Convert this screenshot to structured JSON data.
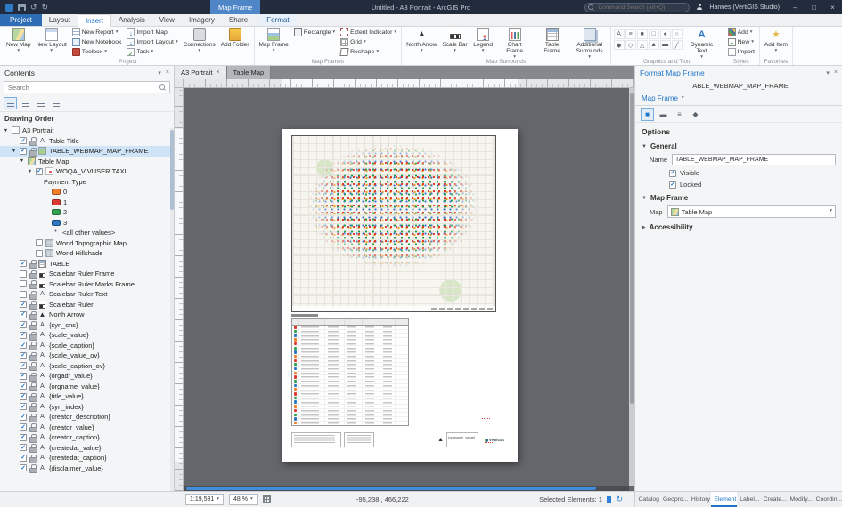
{
  "titlebar": {
    "context_chip": "Map Frame",
    "title": "Untitled - A3 Portrait - ArcGIS Pro",
    "search_placeholder": "Command Search (Alt+Q)",
    "user": "Hannes (VertiGIS Studio)"
  },
  "ribbon": {
    "tabs": [
      {
        "label": "Project",
        "kind": "project"
      },
      {
        "label": "Layout",
        "kind": "normal"
      },
      {
        "label": "Insert",
        "kind": "active"
      },
      {
        "label": "Analysis",
        "kind": "normal"
      },
      {
        "label": "View",
        "kind": "normal"
      },
      {
        "label": "Imagery",
        "kind": "normal"
      },
      {
        "label": "Share",
        "kind": "normal"
      },
      {
        "label": "Format",
        "kind": "contextual"
      }
    ],
    "groups": [
      {
        "label": "Project",
        "cols": [
          {
            "type": "big",
            "items": [
              {
                "label": "New Map",
                "arrow": true,
                "icon": "map"
              },
              {
                "label": "New Layout",
                "arrow": true,
                "icon": "layout"
              }
            ]
          },
          {
            "type": "stack",
            "items": [
              {
                "label": "New Report",
                "arrow": true,
                "icon": "report"
              },
              {
                "label": "New Notebook",
                "icon": "notebook"
              },
              {
                "label": "Toolbox",
                "arrow": true,
                "icon": "toolbox"
              }
            ]
          },
          {
            "type": "stack",
            "items": [
              {
                "label": "Import Map",
                "icon": "importmap"
              },
              {
                "label": "Import Layout",
                "arrow": true,
                "icon": "importmap"
              },
              {
                "label": "Task",
                "arrow": true,
                "icon": "task"
              }
            ]
          },
          {
            "type": "big",
            "items": [
              {
                "label": "Connections",
                "arrow": true,
                "icon": "connections"
              },
              {
                "label": "Add Folder",
                "icon": "folder"
              }
            ]
          }
        ]
      },
      {
        "label": "Map Frames",
        "cols": [
          {
            "type": "big",
            "items": [
              {
                "label": "Map Frame",
                "arrow": true,
                "icon": "mapframe"
              }
            ]
          },
          {
            "type": "stack",
            "items": [
              {
                "label": "Rectangle",
                "arrow": true,
                "icon": "rect"
              }
            ]
          },
          {
            "type": "stack",
            "items": [
              {
                "label": "Extent Indicator",
                "arrow": true,
                "icon": "extent"
              },
              {
                "label": "Grid",
                "arrow": true,
                "icon": "grid"
              },
              {
                "label": "Reshape",
                "arrow": true,
                "icon": "reshape"
              }
            ]
          }
        ]
      },
      {
        "label": "Map Surrounds",
        "cols": [
          {
            "type": "big",
            "items": [
              {
                "label": "North Arrow",
                "arrow": true,
                "icon": "north"
              },
              {
                "label": "Scale Bar",
                "arrow": true,
                "icon": "scalebar"
              },
              {
                "label": "Legend",
                "arrow": true,
                "icon": "legend"
              },
              {
                "label": "Chart Frame",
                "arrow": true,
                "icon": "chart"
              },
              {
                "label": "Table Frame",
                "icon": "tableframe"
              },
              {
                "label": "Additional Surrounds",
                "arrow": true,
                "icon": "addsurr"
              }
            ]
          }
        ]
      },
      {
        "label": "Graphics and Text",
        "cols": [
          {
            "type": "icons",
            "items": [
              "A",
              "≡",
              "■",
              "□",
              "●",
              "○",
              "◆",
              "◇",
              "△",
              "▲",
              "▬",
              "╱"
            ]
          },
          {
            "type": "big",
            "items": [
              {
                "label": "Dynamic Text",
                "arrow": true,
                "icon": "dyntext"
              }
            ]
          }
        ]
      },
      {
        "label": "Styles",
        "cols": [
          {
            "type": "stack",
            "items": [
              {
                "label": "Add",
                "arrow": true,
                "icon": "styleadd"
              },
              {
                "label": "New",
                "arrow": true,
                "icon": "stylenew"
              },
              {
                "label": "Import",
                "icon": "importmap"
              }
            ]
          }
        ]
      },
      {
        "label": "Favorites",
        "cols": [
          {
            "type": "big",
            "items": [
              {
                "label": "Add Item",
                "arrow": true,
                "icon": "additem"
              }
            ]
          }
        ]
      }
    ]
  },
  "contents": {
    "title": "Contents",
    "search_placeholder": "Search",
    "section": "Drawing Order",
    "tree": [
      {
        "label": "A3 Portrait",
        "level": 0,
        "icon": "page",
        "expand": true
      },
      {
        "label": "Table Title",
        "level": 1,
        "check": "on",
        "lock": true,
        "icon": "textel"
      },
      {
        "label": "TABLE_WEBMAP_MAP_FRAME",
        "level": 1,
        "check": "on",
        "lock": true,
        "icon": "mapframe",
        "expand": true,
        "selected": true
      },
      {
        "label": "Table Map",
        "level": 2,
        "icon": "map",
        "expand": true
      },
      {
        "label": "WOQA_V:VUSER.TAXI",
        "level": 3,
        "check": "on",
        "icon": "layer",
        "expand": true
      },
      {
        "label": "Payment Type",
        "level": 4
      },
      {
        "label": "0",
        "level": 5,
        "icon": "swatch",
        "color": "#f07f29"
      },
      {
        "label": "1",
        "level": 5,
        "icon": "swatch",
        "color": "#e03b33"
      },
      {
        "label": "2",
        "level": 5,
        "icon": "swatch",
        "color": "#33a352"
      },
      {
        "label": "3",
        "level": 5,
        "icon": "swatch",
        "color": "#2e78c0"
      },
      {
        "label": "<all other values>",
        "level": 5,
        "icon": "dotsym"
      },
      {
        "label": "World Topographic Map",
        "level": 3,
        "check": "off",
        "icon": "basemap"
      },
      {
        "label": "World Hillshade",
        "level": 3,
        "check": "off",
        "icon": "basemap"
      },
      {
        "label": "TABLE",
        "level": 1,
        "check": "on",
        "lock": true,
        "icon": "tableel"
      },
      {
        "label": "Scalebar Ruler Frame",
        "level": 1,
        "check": "off",
        "lock": true,
        "icon": "scalebar"
      },
      {
        "label": "Scalebar Ruler Marks Frame",
        "level": 1,
        "check": "off",
        "lock": true,
        "icon": "scalebar"
      },
      {
        "label": "Scalebar Ruler Text",
        "level": 1,
        "check": "off",
        "lock": true,
        "icon": "textel"
      },
      {
        "label": "Scalebar Ruler",
        "level": 1,
        "check": "on",
        "lock": true,
        "icon": "scalebar"
      },
      {
        "label": "North Arrow",
        "level": 1,
        "check": "on",
        "lock": true,
        "icon": "north"
      },
      {
        "label": "{syn_cns}",
        "level": 1,
        "check": "on",
        "lock": true,
        "icon": "textel"
      },
      {
        "label": "{scale_value}",
        "level": 1,
        "check": "on",
        "lock": true,
        "icon": "textel"
      },
      {
        "label": "{scale_caption}",
        "level": 1,
        "check": "on",
        "lock": true,
        "icon": "textel"
      },
      {
        "label": "{scale_value_ov}",
        "level": 1,
        "check": "on",
        "lock": true,
        "icon": "textel"
      },
      {
        "label": "{scale_caption_ov}",
        "level": 1,
        "check": "on",
        "lock": true,
        "icon": "textel"
      },
      {
        "label": "{orgadr_value}",
        "level": 1,
        "check": "on",
        "lock": true,
        "icon": "textel"
      },
      {
        "label": "{orgname_value}",
        "level": 1,
        "check": "on",
        "lock": true,
        "icon": "textel"
      },
      {
        "label": "{title_value}",
        "level": 1,
        "check": "on",
        "lock": true,
        "icon": "textel"
      },
      {
        "label": "{syn_index}",
        "level": 1,
        "check": "on",
        "lock": true,
        "icon": "textel"
      },
      {
        "label": "{creator_description}",
        "level": 1,
        "check": "on",
        "lock": true,
        "icon": "textel"
      },
      {
        "label": "{creator_value}",
        "level": 1,
        "check": "on",
        "lock": true,
        "icon": "textel"
      },
      {
        "label": "{creator_caption}",
        "level": 1,
        "check": "on",
        "lock": true,
        "icon": "textel"
      },
      {
        "label": "{createdat_value}",
        "level": 1,
        "check": "on",
        "lock": true,
        "icon": "textel"
      },
      {
        "label": "{createdat_caption}",
        "level": 1,
        "check": "on",
        "lock": true,
        "icon": "textel"
      },
      {
        "label": "{disclaimer_value}",
        "level": 1,
        "check": "on",
        "lock": true,
        "icon": "textel"
      }
    ]
  },
  "view": {
    "tabs": [
      {
        "label": "A3 Portrait",
        "active": true,
        "closable": true
      },
      {
        "label": "Table Map",
        "active": false
      }
    ],
    "page": {
      "orgname": "{orgname_value}",
      "logo": "VertiGIS",
      "row_colors": [
        "#f07f29",
        "#e03b33",
        "#33a352",
        "#2e78c0"
      ]
    }
  },
  "statusbar": {
    "scale": "1:19,531",
    "zoom": "48 %",
    "coords": "-95,238 , 466,222",
    "selected": "Selected Elements: 1"
  },
  "bottom_tabs": [
    {
      "label": "Catalog"
    },
    {
      "label": "Geopro..."
    },
    {
      "label": "History"
    },
    {
      "label": "Element",
      "active": true
    },
    {
      "label": "Label..."
    },
    {
      "label": "Create..."
    },
    {
      "label": "Modify..."
    },
    {
      "label": "Coordin..."
    }
  ],
  "format_panel": {
    "title": "Format Map Frame",
    "subtitle": "TABLE_WEBMAP_MAP_FRAME",
    "selector": "Map Frame",
    "options_label": "Options",
    "general_label": "General",
    "name_label": "Name",
    "name_value": "TABLE_WEBMAP_MAP_FRAME",
    "visible_label": "Visible",
    "locked_label": "Locked",
    "mapframe_label": "Map Frame",
    "map_label": "Map",
    "map_value": "Table Map",
    "accessibility_label": "Accessibility"
  }
}
